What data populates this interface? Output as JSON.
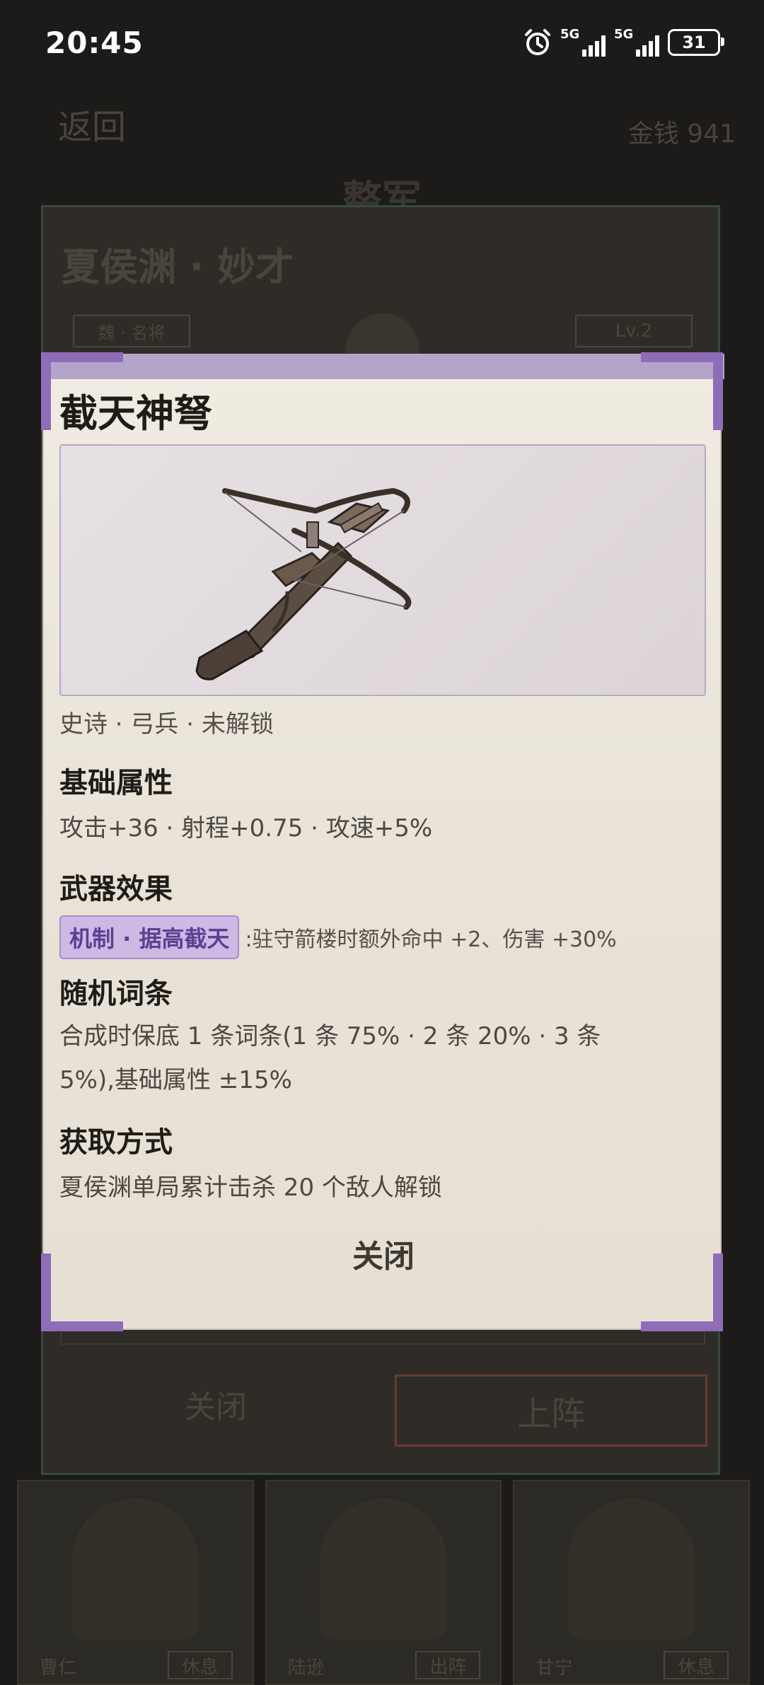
{
  "status_bar": {
    "time": "20:45",
    "signal1_label": "5G",
    "signal2_label": "5G",
    "battery": "31",
    "icons": [
      "alarm-icon",
      "signal-icon",
      "signal-icon",
      "battery-icon"
    ]
  },
  "background": {
    "back_label": "返回",
    "money_label": "金钱 941",
    "page_title": "整军",
    "hero_name": "夏侯渊 · 妙才",
    "faction_tag": "魏 · 名将",
    "level": "Lv.2",
    "close_label": "关闭",
    "deploy_label": "上阵",
    "roster": [
      {
        "name": "曹仁",
        "status": "休息"
      },
      {
        "name": "陆逊",
        "status": "出阵"
      },
      {
        "name": "甘宁",
        "status": "休息"
      }
    ]
  },
  "modal": {
    "title": "截天神弩",
    "subtitle": "史诗 · 弓兵 · 未解锁",
    "sections": {
      "basic_title": "基础属性",
      "basic_text": "攻击+36 · 射程+0.75 · 攻速+5%",
      "effect_title": "武器效果",
      "effect_badge": "机制 · 据高截天",
      "effect_text": ":驻守箭楼时额外命中 +2、伤害 +30%",
      "random_title": "随机词条",
      "random_text_1": "合成时保底 1 条词条(1 条 75% · 2 条 20% · 3 条",
      "random_text_2": "5%),基础属性 ±15%",
      "obtain_title": "获取方式",
      "obtain_text": "夏侯渊单局累计击杀 20 个敌人解锁"
    },
    "close_label": "关闭",
    "accent_color": "#8e6db8",
    "image_icon": "crossbow-icon"
  }
}
